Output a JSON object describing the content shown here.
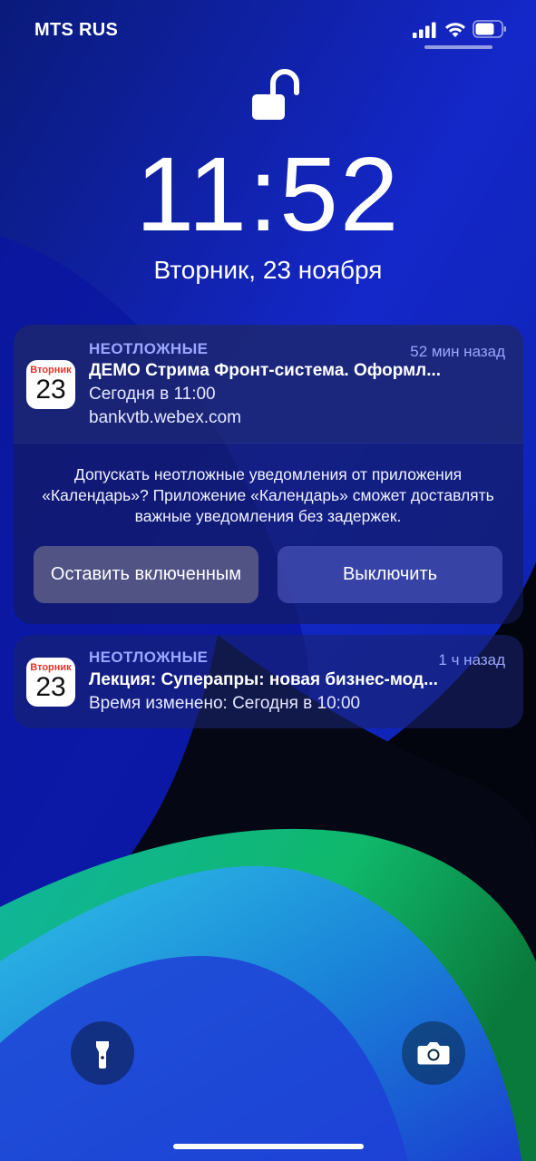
{
  "status_bar": {
    "carrier": "MTS RUS",
    "signal_icon": "cellular-signal-icon",
    "wifi_icon": "wifi-icon",
    "battery_icon": "battery-icon"
  },
  "lock": {
    "icon": "unlocked-padlock-icon"
  },
  "time": "11:52",
  "date": "Вторник, 23 ноября",
  "notifications": [
    {
      "icon": "calendar-icon",
      "icon_day": "Вторник",
      "icon_date": "23",
      "app_label": "НЕОТЛОЖНЫЕ",
      "time_ago": "52 мин назад",
      "title": "ДЕМО Стрима Фронт-система. Оформл...",
      "line1": "Сегодня в 11:00",
      "line2": "bankvtb.webex.com"
    },
    {
      "icon": "calendar-icon",
      "icon_day": "Вторник",
      "icon_date": "23",
      "app_label": "НЕОТЛОЖНЫЕ",
      "time_ago": "1 ч назад",
      "title": "Лекция: Суперапры: новая бизнес-мод...",
      "line1": "Время изменено: Сегодня в 10:00"
    }
  ],
  "prompt": {
    "text": "Допускать неотложные уведомления от приложения «Календарь»? Приложение «Календарь» сможет доставлять важные уведомления без задержек.",
    "keep_label": "Оставить включенным",
    "off_label": "Выключить"
  },
  "quick_actions": {
    "flashlight_icon": "flashlight-icon",
    "camera_icon": "camera-icon"
  },
  "colors": {
    "accent_label": "#9aa6ff",
    "calendar_day": "#e8322b"
  }
}
